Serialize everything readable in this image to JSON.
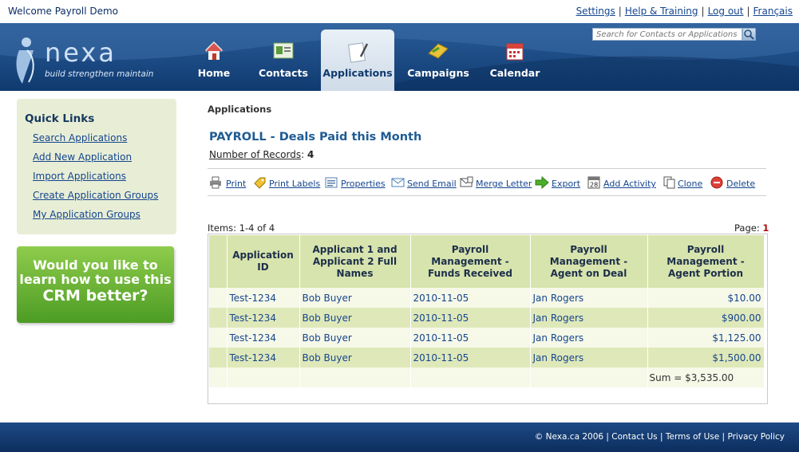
{
  "topbar": {
    "welcome": "Welcome Payroll Demo",
    "links": [
      "Settings",
      "Help & Training",
      "Log out",
      "Français"
    ]
  },
  "logo": {
    "word": "nexa",
    "tagline": "build strengthen maintain"
  },
  "nav": {
    "items": [
      {
        "label": "Home",
        "icon": "house-icon"
      },
      {
        "label": "Contacts",
        "icon": "contacts-card-icon"
      },
      {
        "label": "Applications",
        "icon": "document-pencil-icon",
        "active": true
      },
      {
        "label": "Campaigns",
        "icon": "campaign-icon"
      },
      {
        "label": "Calendar",
        "icon": "calendar-icon"
      }
    ]
  },
  "search": {
    "placeholder": "Search for Contacts or Applications"
  },
  "quick_links": {
    "title": "Quick Links",
    "items": [
      "Search Applications",
      "Add New Application",
      "Import Applications",
      "Create Application Groups",
      "My Application Groups"
    ]
  },
  "promo": {
    "lines": [
      "Would you like to",
      "learn how to use this",
      "CRM better?"
    ]
  },
  "main": {
    "breadcrumb": "Applications",
    "title": "PAYROLL - Deals Paid this Month",
    "records_label": "Number of Records",
    "records_sep": ":",
    "records_count": "4",
    "toolbar": [
      {
        "label": "Print",
        "icon": "printer-icon"
      },
      {
        "label": "Print Labels",
        "icon": "label-tag-icon"
      },
      {
        "label": "Properties",
        "icon": "properties-list-icon"
      },
      {
        "label": "Send Email",
        "icon": "envelope-icon"
      },
      {
        "label": "Merge Letter",
        "icon": "merge-letter-icon"
      },
      {
        "label": "Export",
        "icon": "export-arrow-icon"
      },
      {
        "label": "Add Activity",
        "icon": "calendar-day-icon"
      },
      {
        "label": "Clone",
        "icon": "clone-pages-icon"
      },
      {
        "label": "Delete",
        "icon": "delete-circle-icon"
      }
    ],
    "items_info": "Items: 1-4 of 4",
    "page_label": "Page:",
    "page_number": "1"
  },
  "grid": {
    "headers": [
      "Application ID",
      "Applicant 1 and Applicant 2 Full Names",
      "Payroll Management - Funds Received",
      "Payroll Management - Agent on Deal",
      "Payroll Management - Agent Portion"
    ],
    "rows": [
      [
        "Test-1234",
        "Bob Buyer",
        "2010-11-05",
        "Jan Rogers",
        "$10.00"
      ],
      [
        "Test-1234",
        "Bob Buyer",
        "2010-11-05",
        "Jan Rogers",
        "$900.00"
      ],
      [
        "Test-1234",
        "Bob Buyer",
        "2010-11-05",
        "Jan Rogers",
        "$1,125.00"
      ],
      [
        "Test-1234",
        "Bob Buyer",
        "2010-11-05",
        "Jan Rogers",
        "$1,500.00"
      ]
    ],
    "sum": "Sum = $3,535.00"
  },
  "footer": {
    "copyright": "© Nexa.ca 2006",
    "links": [
      "Contact Us",
      "Terms of Use",
      "Privacy Policy"
    ]
  },
  "colors": {
    "header_blue": "#1f4f8c",
    "grid_header": "#d8e4ad",
    "row_alt": "#dfe8b9",
    "link": "#14458f",
    "promo_green": "#6cb436"
  }
}
